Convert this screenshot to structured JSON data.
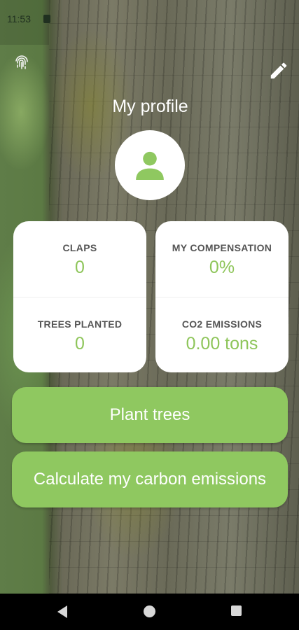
{
  "status_bar": {
    "time": "11:53"
  },
  "header": {
    "title": "My profile"
  },
  "icons": {
    "fingerprint": "fingerprint-icon",
    "edit": "pencil-icon",
    "avatar": "person-icon"
  },
  "stats": {
    "claps": {
      "label": "CLAPS",
      "value": "0"
    },
    "compensation": {
      "label": "MY COMPENSATION",
      "value": "0%"
    },
    "trees": {
      "label": "TREES PLANTED",
      "value": "0"
    },
    "emissions": {
      "label": "CO2 EMISSIONS",
      "value": "0.00 tons"
    }
  },
  "actions": {
    "plant_trees": "Plant trees",
    "calculate": "Calculate my carbon emissions"
  },
  "colors": {
    "accent": "#8fc860",
    "value_text": "#8ec55a"
  }
}
